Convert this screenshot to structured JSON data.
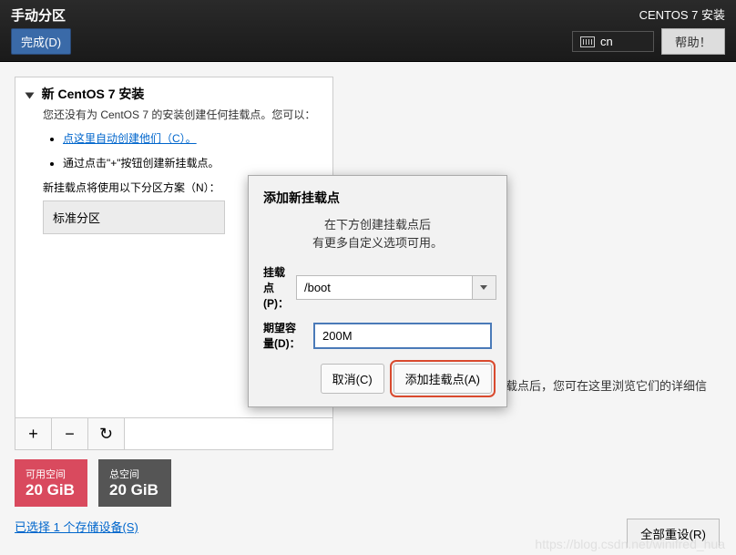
{
  "topbar": {
    "title": "手动分区",
    "done": "完成(D)",
    "installer": "CENTOS 7 安装",
    "lang": "cn",
    "help": "帮助！"
  },
  "panel": {
    "title": "新 CentOS 7 安装",
    "desc": "您还没有为 CentOS 7 的安装创建任何挂载点。您可以：",
    "auto_link": "点这里自动创建他们（C）。",
    "plus_hint": "通过点击\"+\"按钮创建新挂载点。",
    "scheme_label": "新挂载点将使用以下分区方案（N）：",
    "scheme_value": "标准分区"
  },
  "space": {
    "avail_label": "可用空间",
    "avail_value": "20 GiB",
    "total_label": "总空间",
    "total_value": "20 GiB"
  },
  "storage_link": "已选择 1 个存储设备(S)",
  "right_info": "载点后，您可在这里浏览它们的详细信",
  "reset": "全部重设(R)",
  "modal": {
    "title": "添加新挂载点",
    "desc_l1": "在下方创建挂载点后",
    "desc_l2": "有更多自定义选项可用。",
    "mount_label": "挂载点(P)：",
    "mount_value": "/boot",
    "size_label": "期望容量(D)：",
    "size_value": "200M",
    "cancel": "取消(C)",
    "add": "添加挂载点(A)"
  },
  "watermark": "https://blog.csdn.net/winifred_hua"
}
